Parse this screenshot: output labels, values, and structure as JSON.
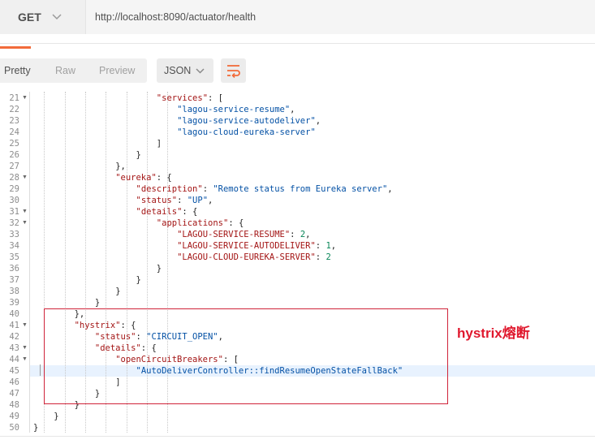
{
  "request": {
    "method": "GET",
    "url": "http://localhost:8090/actuator/health"
  },
  "response_toolbar": {
    "views": [
      "Pretty",
      "Raw",
      "Preview"
    ],
    "active_view": "Pretty",
    "format": "JSON"
  },
  "icons": {
    "method_dropdown": "chevron-down-icon",
    "format_dropdown": "chevron-down-icon",
    "wrap": "wrap-lines-icon"
  },
  "colors": {
    "accent": "#f26b3a",
    "json_key": "#a31515",
    "json_string": "#0451a5",
    "json_number": "#098658",
    "annotation": "#e0192e"
  },
  "code": {
    "highlighted_line": 45,
    "lines": [
      {
        "n": "21",
        "fold": true,
        "indent": 6,
        "parts": [
          [
            "k",
            "\"services\""
          ],
          [
            "p",
            ": ["
          ]
        ]
      },
      {
        "n": "22",
        "fold": false,
        "indent": 7,
        "parts": [
          [
            "s",
            "\"lagou-service-resume\""
          ],
          [
            "p",
            ","
          ]
        ]
      },
      {
        "n": "23",
        "fold": false,
        "indent": 7,
        "parts": [
          [
            "s",
            "\"lagou-service-autodeliver\""
          ],
          [
            "p",
            ","
          ]
        ]
      },
      {
        "n": "24",
        "fold": false,
        "indent": 7,
        "parts": [
          [
            "s",
            "\"lagou-cloud-eureka-server\""
          ]
        ]
      },
      {
        "n": "25",
        "fold": false,
        "indent": 6,
        "parts": [
          [
            "p",
            "]"
          ]
        ]
      },
      {
        "n": "26",
        "fold": false,
        "indent": 5,
        "parts": [
          [
            "p",
            "}"
          ]
        ]
      },
      {
        "n": "27",
        "fold": false,
        "indent": 4,
        "parts": [
          [
            "p",
            "},"
          ]
        ]
      },
      {
        "n": "28",
        "fold": true,
        "indent": 4,
        "parts": [
          [
            "k",
            "\"eureka\""
          ],
          [
            "p",
            ": {"
          ]
        ]
      },
      {
        "n": "29",
        "fold": false,
        "indent": 5,
        "parts": [
          [
            "k",
            "\"description\""
          ],
          [
            "p",
            ": "
          ],
          [
            "s",
            "\"Remote status from Eureka server\""
          ],
          [
            "p",
            ","
          ]
        ]
      },
      {
        "n": "30",
        "fold": false,
        "indent": 5,
        "parts": [
          [
            "k",
            "\"status\""
          ],
          [
            "p",
            ": "
          ],
          [
            "s",
            "\"UP\""
          ],
          [
            "p",
            ","
          ]
        ]
      },
      {
        "n": "31",
        "fold": true,
        "indent": 5,
        "parts": [
          [
            "k",
            "\"details\""
          ],
          [
            "p",
            ": {"
          ]
        ]
      },
      {
        "n": "32",
        "fold": true,
        "indent": 6,
        "parts": [
          [
            "k",
            "\"applications\""
          ],
          [
            "p",
            ": {"
          ]
        ]
      },
      {
        "n": "33",
        "fold": false,
        "indent": 7,
        "parts": [
          [
            "k",
            "\"LAGOU-SERVICE-RESUME\""
          ],
          [
            "p",
            ": "
          ],
          [
            "n",
            "2"
          ],
          [
            "p",
            ","
          ]
        ]
      },
      {
        "n": "34",
        "fold": false,
        "indent": 7,
        "parts": [
          [
            "k",
            "\"LAGOU-SERVICE-AUTODELIVER\""
          ],
          [
            "p",
            ": "
          ],
          [
            "n",
            "1"
          ],
          [
            "p",
            ","
          ]
        ]
      },
      {
        "n": "35",
        "fold": false,
        "indent": 7,
        "parts": [
          [
            "k",
            "\"LAGOU-CLOUD-EUREKA-SERVER\""
          ],
          [
            "p",
            ": "
          ],
          [
            "n",
            "2"
          ]
        ]
      },
      {
        "n": "36",
        "fold": false,
        "indent": 6,
        "parts": [
          [
            "p",
            "}"
          ]
        ]
      },
      {
        "n": "37",
        "fold": false,
        "indent": 5,
        "parts": [
          [
            "p",
            "}"
          ]
        ]
      },
      {
        "n": "38",
        "fold": false,
        "indent": 4,
        "parts": [
          [
            "p",
            "}"
          ]
        ]
      },
      {
        "n": "39",
        "fold": false,
        "indent": 3,
        "parts": [
          [
            "p",
            "}"
          ]
        ]
      },
      {
        "n": "40",
        "fold": false,
        "indent": 2,
        "parts": [
          [
            "p",
            "},"
          ]
        ]
      },
      {
        "n": "41",
        "fold": true,
        "indent": 2,
        "parts": [
          [
            "k",
            "\"hystrix\""
          ],
          [
            "p",
            ": {"
          ]
        ]
      },
      {
        "n": "42",
        "fold": false,
        "indent": 3,
        "parts": [
          [
            "k",
            "\"status\""
          ],
          [
            "p",
            ": "
          ],
          [
            "s",
            "\"CIRCUIT_OPEN\""
          ],
          [
            "p",
            ","
          ]
        ]
      },
      {
        "n": "43",
        "fold": true,
        "indent": 3,
        "parts": [
          [
            "k",
            "\"details\""
          ],
          [
            "p",
            ": {"
          ]
        ]
      },
      {
        "n": "44",
        "fold": true,
        "indent": 4,
        "parts": [
          [
            "k",
            "\"openCircuitBreakers\""
          ],
          [
            "p",
            ": ["
          ]
        ]
      },
      {
        "n": "45",
        "fold": false,
        "indent": 5,
        "parts": [
          [
            "s",
            "\"AutoDeliverController::findResumeOpenStateFallBack\""
          ]
        ]
      },
      {
        "n": "46",
        "fold": false,
        "indent": 4,
        "parts": [
          [
            "p",
            "]"
          ]
        ]
      },
      {
        "n": "47",
        "fold": false,
        "indent": 3,
        "parts": [
          [
            "p",
            "}"
          ]
        ]
      },
      {
        "n": "48",
        "fold": false,
        "indent": 2,
        "parts": [
          [
            "p",
            "}"
          ]
        ]
      },
      {
        "n": "49",
        "fold": false,
        "indent": 1,
        "parts": [
          [
            "p",
            "}"
          ]
        ]
      },
      {
        "n": "50",
        "fold": false,
        "indent": 0,
        "parts": [
          [
            "p",
            "}"
          ]
        ]
      }
    ]
  },
  "annotation": {
    "text": "hystrix熔断"
  }
}
